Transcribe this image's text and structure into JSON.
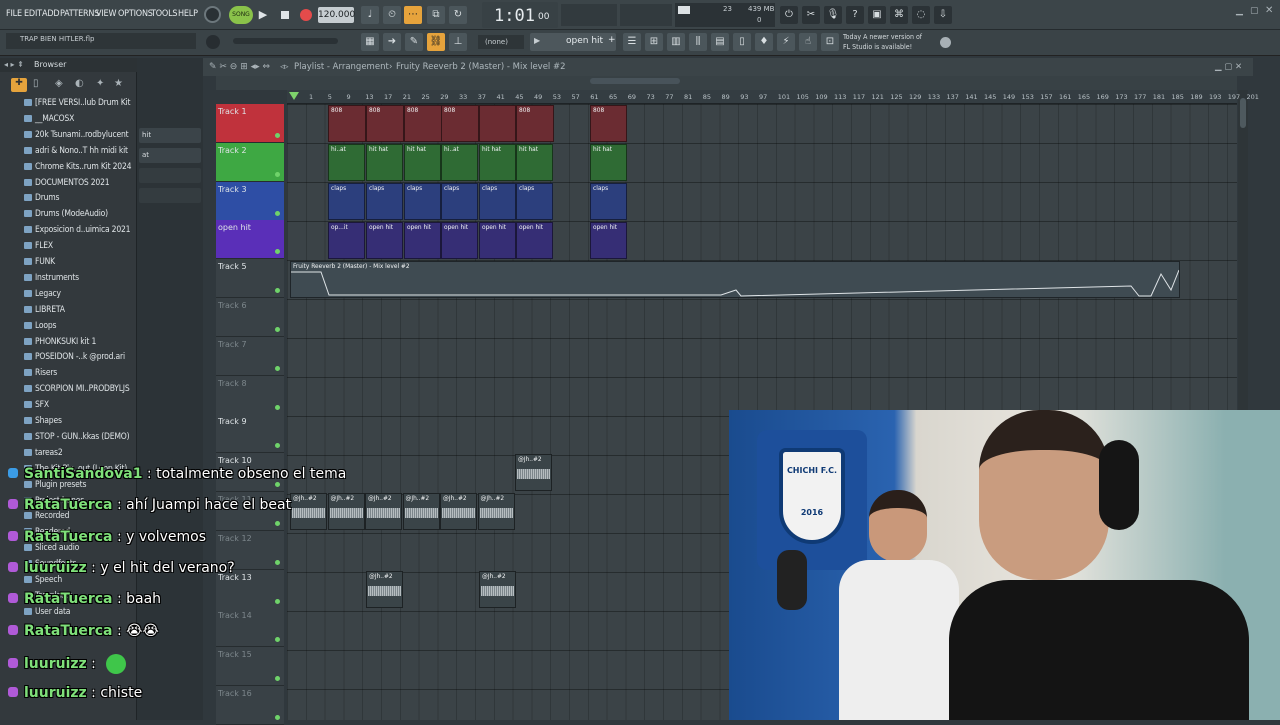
{
  "menu": [
    "FILE",
    "EDIT",
    "ADD",
    "PATTERNS",
    "VIEW",
    "OPTIONS",
    "TOOLS",
    "HELP"
  ],
  "transport": {
    "song_mode": "SONG",
    "tempo": "120.000",
    "time": "1:01",
    "time_frames": "00",
    "cpu": "23",
    "memory": "439 MB",
    "memory_sub": "0"
  },
  "hint": {
    "line1": "Today  A newer version of",
    "line2": "FL Studio is available!"
  },
  "project_file": "TRAP BIEN HITLER.flp",
  "toolbar2": {
    "pattern_none": "(none)",
    "pattern_name": "open hit"
  },
  "browser": {
    "title": "Browser",
    "items": [
      "[FREE VERSI..lub Drum Kit",
      "__MACOSX",
      "20k Tsunami..rodbylucent",
      "adri & Nono..T hh midi kit",
      "Chrome Kits..rum Kit 2024",
      "DOCUMENTOS 2021",
      "Drums",
      "Drums (ModeAudio)",
      "Exposicion d..uimica 2021",
      "FLEX",
      "FUNK",
      "Instruments",
      "Legacy",
      "LIBRETA",
      "Loops",
      "PHONKSUKI kit 1",
      "POSEIDON -..k @prod.ari",
      "Risers",
      "SCORPION MI..PRODBYLJS",
      "SFX",
      "Shapes",
      "STOP - GUN..kkas (DEMO)",
      "tareas2",
      "The Kit Plu..out (Loop Kit)",
      "Plugin presets",
      "Project bones",
      "Recorded",
      "Rendered",
      "Sliced audio",
      "Soundfonts",
      "Speech",
      "Templates",
      "User data"
    ]
  },
  "picker": [
    "hit",
    "at"
  ],
  "playlist": {
    "title": "Playlist - Arrangement",
    "breadcrumb": "Fruity Reeverb 2 (Master) - Mix level #2",
    "ruler": [
      "1",
      "5",
      "9",
      "13",
      "17",
      "21",
      "25",
      "29",
      "33",
      "37",
      "41",
      "45",
      "49",
      "53",
      "57",
      "61",
      "65",
      "69",
      "73",
      "77",
      "81",
      "85",
      "89",
      "93",
      "97",
      "101",
      "105",
      "109",
      "113",
      "117",
      "121",
      "125",
      "129",
      "133",
      "137",
      "141",
      "145",
      "149",
      "153",
      "157",
      "161",
      "165",
      "169",
      "173",
      "177",
      "181",
      "185",
      "189",
      "193",
      "197",
      "201"
    ],
    "tracks": [
      "Track 1",
      "Track 2",
      "Track 3",
      "open hit",
      "Track 5",
      "Track 6",
      "Track 7",
      "Track 8",
      "Track 9",
      "Track 10",
      "Track 11",
      "Track 12",
      "Track 13",
      "Track 14",
      "Track 15",
      "Track 16"
    ],
    "clip_labels": {
      "t1": "808",
      "t2": "hit hat",
      "t2a": "hi..at",
      "t3": "claps",
      "t4": "open hit",
      "t4a": "op...it",
      "auto": "Fruity Reeverb 2 (Master) - Mix level #2",
      "audio": "@Jh..#2"
    }
  },
  "chat": [
    {
      "user": "SantiSandova1",
      "text": "totalmente obseno el tema"
    },
    {
      "user": "RataTuerca",
      "text": "ahí Juampi hace el beat"
    },
    {
      "user": "RataTuerca",
      "text": "y volvemos"
    },
    {
      "user": "luuruizz",
      "text": "y el hit del verano?"
    },
    {
      "user": "RataTuerca",
      "text": "baah"
    },
    {
      "user": "RataTuerca",
      "text": "😭😭"
    },
    {
      "user": "luuruizz",
      "text": ""
    },
    {
      "user": "luuruizz",
      "text": "chiste"
    }
  ],
  "webcam": {
    "banner_text": "CHICHI F.C.",
    "year": "2016"
  }
}
